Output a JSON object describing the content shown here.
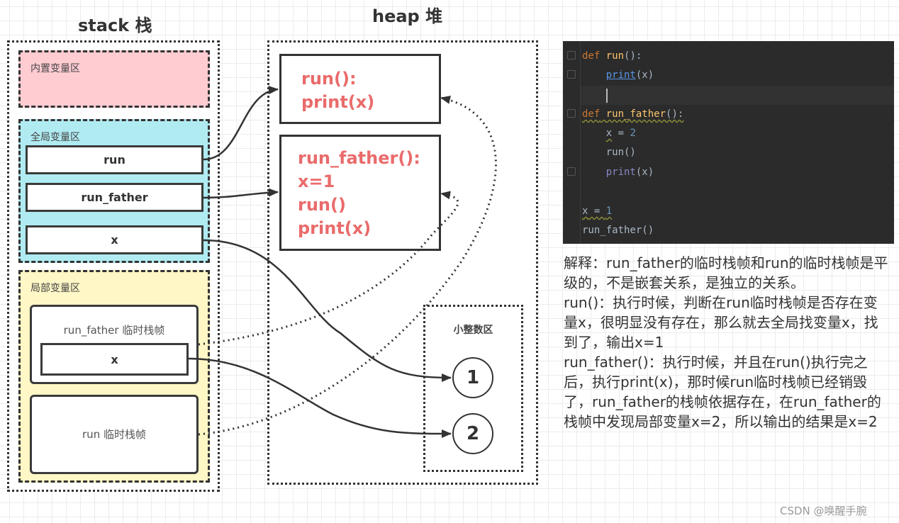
{
  "stack": {
    "title": "stack 栈",
    "builtin_zone": {
      "label": "内置变量区",
      "color": "#ffccd2"
    },
    "global_zone": {
      "label": "全局变量区",
      "color": "#b0ebf2",
      "vars": [
        "run",
        "run_father",
        "x"
      ]
    },
    "local_zone": {
      "label": "局部变量区",
      "color": "#fff7c6",
      "frames": [
        {
          "label": "run_father 临时栈帧",
          "vars": [
            "x"
          ]
        },
        {
          "label": "run 临时栈帧",
          "vars": []
        }
      ]
    }
  },
  "heap": {
    "title": "heap 堆",
    "objects": [
      {
        "lines": [
          "run():",
          "print(x)"
        ]
      },
      {
        "lines": [
          "run_father():",
          "x=1",
          "run()",
          "print(x)"
        ]
      }
    ],
    "small_int_zone": {
      "label": "小整数区",
      "values": [
        "1",
        "2"
      ]
    },
    "text_color": "#ea6b6b"
  },
  "arrows": [
    {
      "from": "global.run",
      "to": "heap.run",
      "style": "solid"
    },
    {
      "from": "global.run_father",
      "to": "heap.run_father",
      "style": "solid"
    },
    {
      "from": "global.x",
      "to": "small_int.1",
      "style": "solid"
    },
    {
      "from": "run_father_frame.x",
      "to": "small_int.2",
      "style": "solid"
    },
    {
      "from": "run_father_frame",
      "to": "heap.run_father",
      "style": "dotted"
    },
    {
      "from": "run_frame",
      "to": "heap.run",
      "style": "dotted"
    }
  ],
  "code_editor": {
    "lines": [
      "def run():",
      "    print(x)",
      "    ",
      "def run_father():",
      "    x = 2",
      "    run()",
      "    print(x)",
      "",
      "x = 1",
      "run_father()"
    ],
    "tokens": {
      "def": "def",
      "run": "run",
      "run_father": "run_father",
      "paren_colon": "():",
      "print": "print",
      "arg_x": "(x)",
      "x": "x",
      "eq": " = ",
      "two": "2",
      "one": "1",
      "run_call": "run()",
      "run_father_call": "run_father()"
    }
  },
  "explanation": {
    "paragraphs": [
      "解释：run_father的临时栈帧和run的临时栈帧是平级的，不是嵌套关系，是独立的关系。",
      "run()：执行时候，判断在run临时栈帧是否存在变量x，很明显没有存在，那么就去全局找变量x，找到了，输出x=1",
      "run_father()：执行时候，并且在run()执行完之后，执行print(x)，那时候run临时栈帧已经销毁了，run_father的栈帧依据存在，在run_father的栈帧中发现局部变量x=2，所以输出的结果是x=2"
    ]
  },
  "watermark": "CSDN @唤醒手腕"
}
